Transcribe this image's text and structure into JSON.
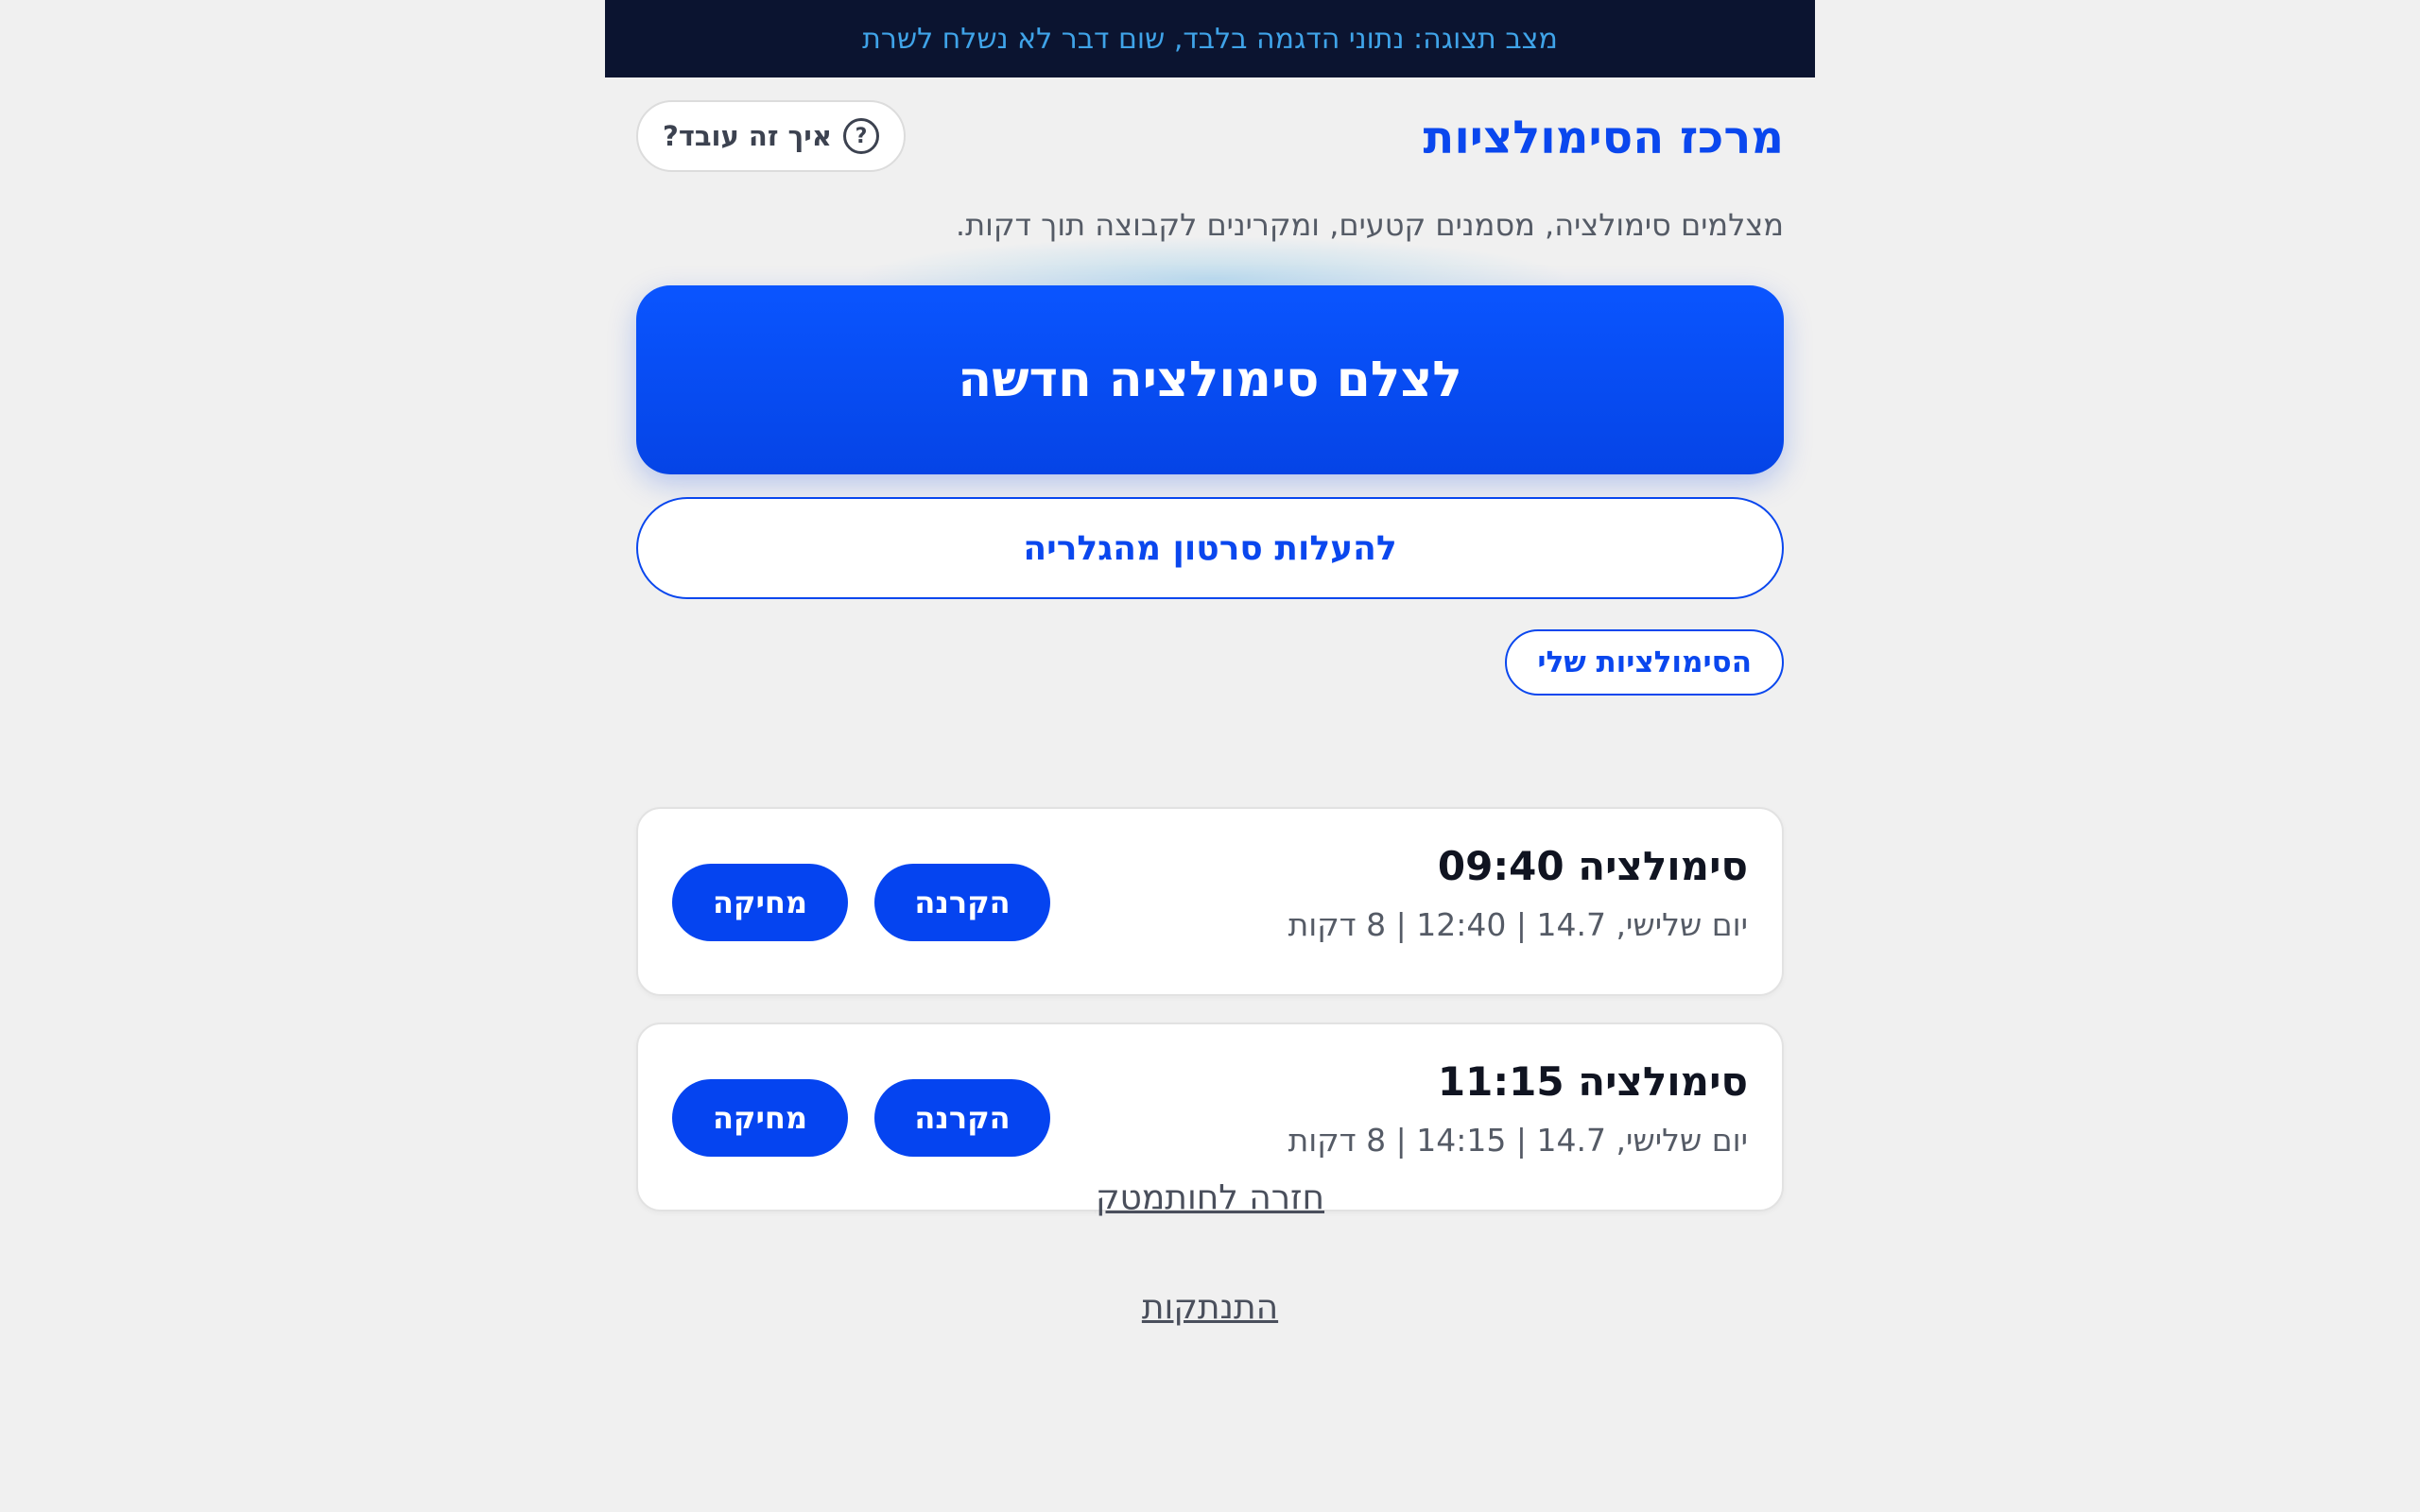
{
  "banner": {
    "text": "מצב תצוגה: נתוני הדגמה בלבד, שום דבר לא נשלח לשרת"
  },
  "header": {
    "title": "מרכז הסימולציות",
    "help_label": "איך זה עובד?",
    "help_icon": "question-circle-icon"
  },
  "subtitle": "מצלמים סימולציה, מסמנים קטעים, ומקרינים לקבוצה תוך דקות.",
  "actions": {
    "record_label": "לצלם סימולציה חדשה",
    "upload_label": "להעלות סרטון מהגלריה"
  },
  "section": {
    "my_sims_label": "הסימולציות שלי"
  },
  "simulations": [
    {
      "title": "סימולציה 09:40",
      "meta": "יום שלישי, 14.7 | 12:40 | 8 דקות",
      "play_label": "הקרנה",
      "delete_label": "מחיקה"
    },
    {
      "title": "סימולציה 11:15",
      "meta": "יום שלישי, 14.7 | 14:15 | 8 דקות",
      "play_label": "הקרנה",
      "delete_label": "מחיקה"
    }
  ],
  "footer": {
    "back_label": "חזרה לחותמטק",
    "logout_label": "התנתקות"
  },
  "colors": {
    "primary": "#0a47ee",
    "banner_bg": "#0b1430",
    "banner_text": "#3fa3e8",
    "page_bg": "#f0f0f0"
  }
}
